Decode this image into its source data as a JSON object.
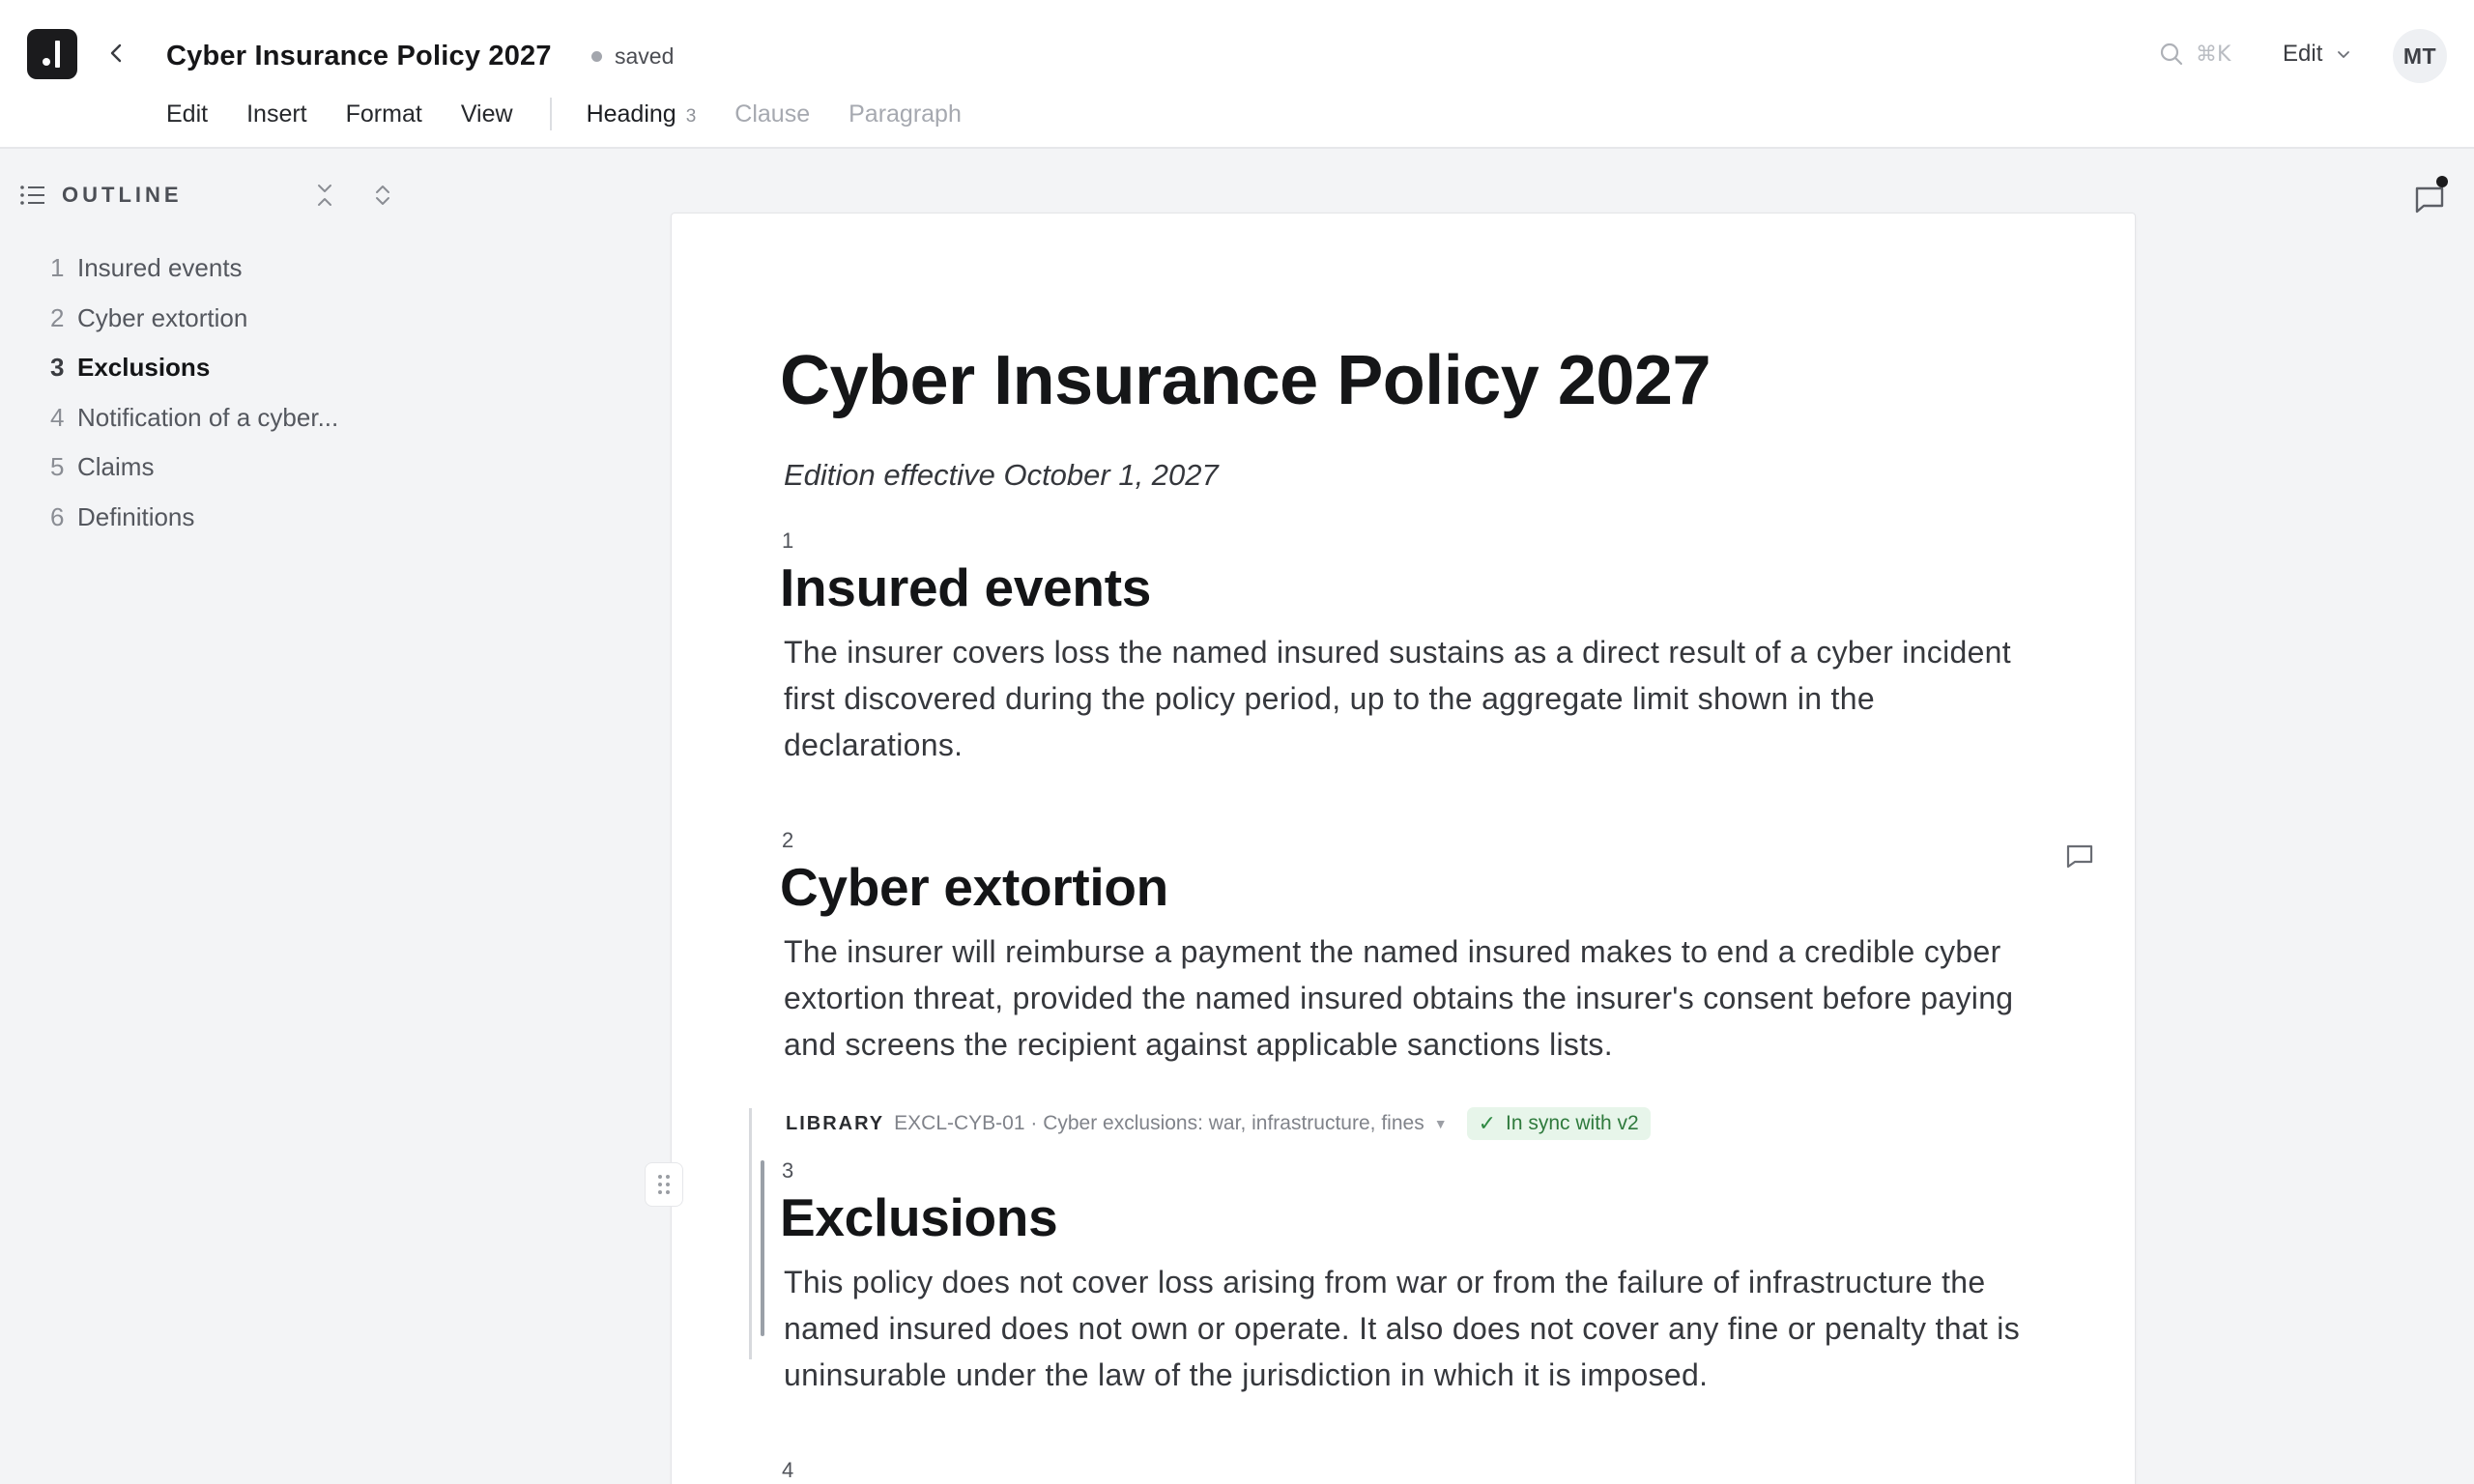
{
  "topbar": {
    "doc_title": "Cyber Insurance Policy 2027",
    "save_status": "saved",
    "search_shortcut": "⌘K",
    "mode_label": "Edit",
    "avatar_initials": "MT"
  },
  "menu": {
    "items": [
      "Edit",
      "Insert",
      "Format",
      "View"
    ],
    "styles": [
      {
        "label": "Heading",
        "level": "3",
        "state": "active"
      },
      {
        "label": "Clause",
        "state": "disabled"
      },
      {
        "label": "Paragraph",
        "state": "disabled"
      }
    ]
  },
  "outline": {
    "title": "OUTLINE",
    "items": [
      {
        "num": "1",
        "label": "Insured events"
      },
      {
        "num": "2",
        "label": "Cyber extortion"
      },
      {
        "num": "3",
        "label": "Exclusions",
        "active": true
      },
      {
        "num": "4",
        "label": "Notification of a cyber..."
      },
      {
        "num": "5",
        "label": "Claims"
      },
      {
        "num": "6",
        "label": "Definitions"
      }
    ]
  },
  "document": {
    "title": "Cyber Insurance Policy 2027",
    "subtitle": "Edition effective October 1, 2027",
    "sections": [
      {
        "num": "1",
        "heading": "Insured events",
        "body": "The insurer covers loss the named insured sustains as a direct result of a cyber incident first discovered during the policy period, up to the aggregate limit shown in the declarations."
      },
      {
        "num": "2",
        "heading": "Cyber extortion",
        "body": "The insurer will reimburse a payment the named insured makes to end a credible cyber extortion threat, provided the named insured obtains the insurer's consent before paying and screens the recipient against applicable sanctions lists."
      },
      {
        "num": "3",
        "heading": "Exclusions",
        "body": "This policy does not cover loss arising from war or from the failure of infrastructure the named insured does not own or operate. It also does not cover any fine or penalty that is uninsurable under the law of the jurisdiction in which it is imposed."
      },
      {
        "num": "4"
      }
    ],
    "library": {
      "label": "LIBRARY",
      "ref": "EXCL-CYB-01 · Cyber exclusions: war, infrastructure, fines",
      "sync_status": "In sync with v2"
    }
  },
  "colors": {
    "brand_dark": "#1b1b1d",
    "sync_green": "#2f7a3d",
    "sync_bg": "#e7f5ea"
  }
}
